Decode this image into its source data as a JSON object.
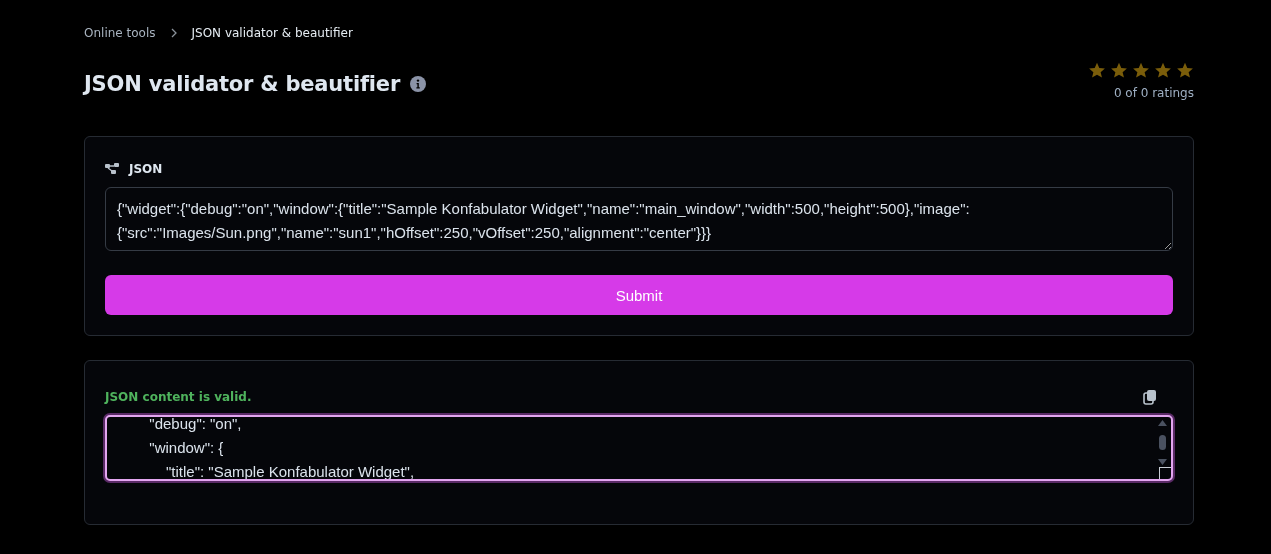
{
  "breadcrumb": [
    {
      "label": "Online tools"
    },
    {
      "label": "JSON validator & beautifier"
    }
  ],
  "title": "JSON validator & beautifier",
  "rating": {
    "stars": 5,
    "count": "0 of 0 ratings"
  },
  "input_panel": {
    "label": "JSON",
    "value": "{\"widget\":{\"debug\":\"on\",\"window\":{\"title\":\"Sample Konfabulator Widget\",\"name\":\"main_window\",\"width\":500,\"height\":500},\"image\":{\"src\":\"Images/Sun.png\",\"name\":\"sun1\",\"hOffset\":250,\"vOffset\":250,\"alignment\":\"center\"}}}",
    "submit": "Submit"
  },
  "output_panel": {
    "status": "JSON content is valid.",
    "lines": [
      "        \"debug\": \"on\",",
      "        \"window\": {",
      "            \"title\": \"Sample Konfabulator Widget\","
    ]
  }
}
